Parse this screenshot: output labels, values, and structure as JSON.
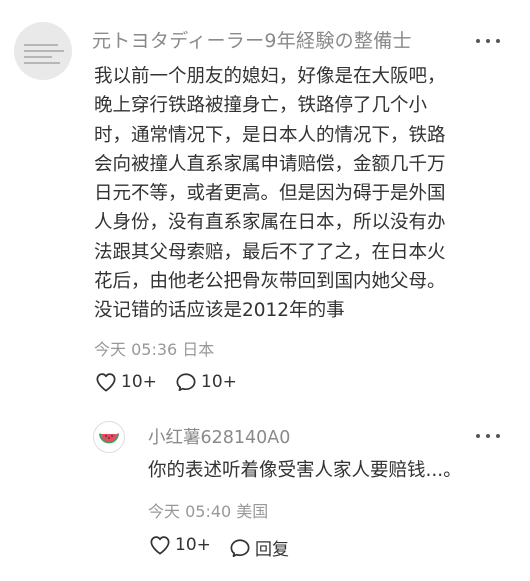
{
  "comment": {
    "username": "元トヨタディーラー9年経験の整備士",
    "body_lines": [
      "我以前一个朋友的媳妇，好像是在大阪吧，",
      "晚上穿行铁路被撞身亡，铁路停了几个小",
      "时，通常情况下，是日本人的情况下，铁路",
      "会向被撞人直系家属申请赔偿，金额几千万",
      "日元不等，或者更高。但是因为碍于是外国",
      "人身份，没有直系家属在日本，所以没有办",
      "法跟其父母索赔，最后不了了之，在日本火",
      "花后，由他老公把骨灰带回到国内她父母。",
      "没记错的话应该是2012年的事"
    ],
    "meta": "今天 05:36 日本",
    "likes": "10+",
    "replies": "10+"
  },
  "reply": {
    "username": "小红薯628140A0",
    "text": "你的表述听着像受害人家人要赔钱...。",
    "meta": "今天 05:40 美国",
    "likes": "10+",
    "reply_label": "回复"
  },
  "icons": {
    "more": "more-dots-icon",
    "like": "heart-icon",
    "comment": "chat-bubble-icon",
    "reply_avatar": "watermelon-icon"
  },
  "colors": {
    "text": "#333333",
    "muted": "#8a8a8a",
    "meta": "#999999",
    "watermelon_red": "#e84a5f",
    "watermelon_green": "#3aa05a"
  }
}
